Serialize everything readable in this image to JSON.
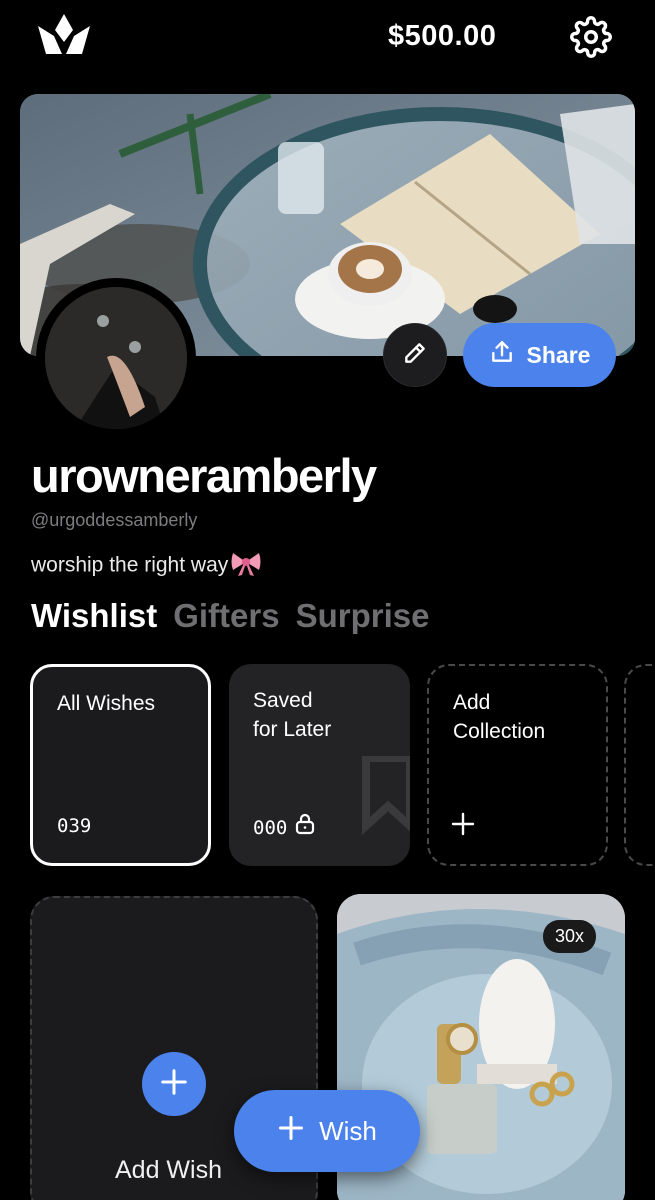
{
  "header": {
    "logo": "crown-logo",
    "balance": "$500.00",
    "settings_icon": "gear-icon"
  },
  "profile": {
    "username": "urowneramberly",
    "handle": "@urgoddessamberly",
    "bio": "worship the right way",
    "share_label": "Share",
    "edit_icon": "pencil-icon",
    "share_icon": "share-upload-icon"
  },
  "tabs": [
    {
      "label": "Wishlist",
      "active": true
    },
    {
      "label": "Gifters",
      "active": false
    },
    {
      "label": "Surprise",
      "active": false
    }
  ],
  "collections": [
    {
      "title_line1": "All Wishes",
      "title_line2": "",
      "count": "039"
    },
    {
      "title_line1": "Saved",
      "title_line2": "for Later",
      "count": "000"
    },
    {
      "title_line1": "Add",
      "title_line2": "Collection",
      "count": ""
    }
  ],
  "wish_grid": {
    "add_label": "Add Wish",
    "product_quantity": "30x"
  },
  "fab": {
    "label": "Wish"
  },
  "colors": {
    "accent": "#4b82ec",
    "background": "#000000",
    "card": "#1b1b1d"
  }
}
